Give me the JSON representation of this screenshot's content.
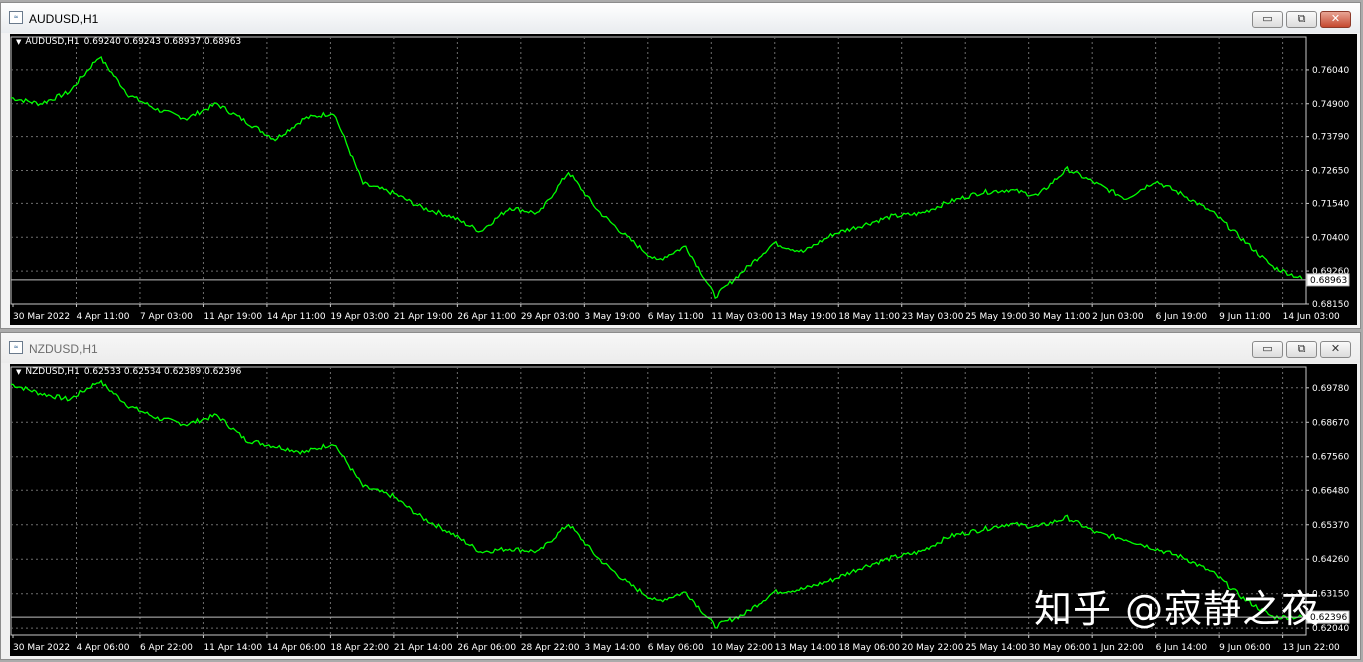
{
  "windows": [
    {
      "title": "AUDUSD,H1",
      "info": {
        "symbol": "AUDUSD,H1",
        "open": "0.69240",
        "high": "0.69243",
        "low": "0.68937",
        "close": "0.68963"
      },
      "buttons": {
        "minimize": "▭",
        "restore": "⧉",
        "close": "✕"
      },
      "chart_data": {
        "type": "line",
        "title": "",
        "line_color": "#00ff00",
        "grid": true,
        "ylim": [
          0.6815,
          0.7715
        ],
        "y_ticks": [
          "0.76040",
          "0.74900",
          "0.73790",
          "0.72650",
          "0.71540",
          "0.70400",
          "0.69260",
          "0.68150"
        ],
        "current_price": "0.68963",
        "x_ticks": [
          "30 Mar 2022",
          "4 Apr 11:00",
          "7 Apr 03:00",
          "11 Apr 19:00",
          "14 Apr 11:00",
          "19 Apr 03:00",
          "21 Apr 19:00",
          "26 Apr 11:00",
          "29 Apr 03:00",
          "3 May 19:00",
          "6 May 11:00",
          "11 May 03:00",
          "13 May 19:00",
          "18 May 11:00",
          "23 May 03:00",
          "25 May 19:00",
          "30 May 11:00",
          "2 Jun 03:00",
          "6 Jun 19:00",
          "9 Jun 11:00",
          "14 Jun 03:00"
        ],
        "series": [
          {
            "values": [
              0.751,
              0.749,
              0.753,
              0.765,
              0.752,
              0.747,
              0.744,
              0.749,
              0.743,
              0.737,
              0.744,
              0.746,
              0.722,
              0.719,
              0.714,
              0.711,
              0.706,
              0.714,
              0.712,
              0.726,
              0.713,
              0.704,
              0.696,
              0.701,
              0.684,
              0.693,
              0.702,
              0.699,
              0.705,
              0.708,
              0.711,
              0.712,
              0.716,
              0.719,
              0.72,
              0.718,
              0.727,
              0.722,
              0.717,
              0.723,
              0.718,
              0.712,
              0.703,
              0.694,
              0.69
            ]
          }
        ]
      }
    },
    {
      "title": "NZDUSD,H1",
      "info": {
        "symbol": "NZDUSD,H1",
        "open": "0.62533",
        "high": "0.62534",
        "low": "0.62389",
        "close": "0.62396"
      },
      "buttons": {
        "minimize": "▭",
        "restore": "⧉",
        "close": "✕"
      },
      "chart_data": {
        "type": "line",
        "title": "",
        "line_color": "#00ff00",
        "grid": true,
        "ylim": [
          0.6182,
          0.7045
        ],
        "y_ticks": [
          "0.69780",
          "0.68670",
          "0.67560",
          "0.66480",
          "0.65370",
          "0.64260",
          "0.63150",
          "0.62040"
        ],
        "current_price": "0.62396",
        "x_ticks": [
          "30 Mar 2022",
          "4 Apr 06:00",
          "6 Apr 22:00",
          "11 Apr 14:00",
          "14 Apr 06:00",
          "18 Apr 22:00",
          "21 Apr 14:00",
          "26 Apr 06:00",
          "28 Apr 22:00",
          "3 May 14:00",
          "6 May 06:00",
          "10 May 22:00",
          "13 May 14:00",
          "18 May 06:00",
          "20 May 22:00",
          "25 May 14:00",
          "30 May 06:00",
          "1 Jun 22:00",
          "6 Jun 14:00",
          "9 Jun 06:00",
          "13 Jun 22:00"
        ],
        "series": [
          {
            "values": [
              0.699,
              0.696,
              0.694,
              0.7,
              0.692,
              0.688,
              0.686,
              0.689,
              0.681,
              0.679,
              0.677,
              0.68,
              0.666,
              0.663,
              0.656,
              0.651,
              0.645,
              0.646,
              0.645,
              0.654,
              0.643,
              0.635,
              0.629,
              0.632,
              0.621,
              0.625,
              0.632,
              0.633,
              0.636,
              0.64,
              0.643,
              0.645,
              0.65,
              0.652,
              0.654,
              0.653,
              0.656,
              0.651,
              0.649,
              0.646,
              0.643,
              0.638,
              0.63,
              0.624,
              0.624
            ]
          }
        ]
      }
    }
  ],
  "watermark": "知乎 @寂静之夜"
}
